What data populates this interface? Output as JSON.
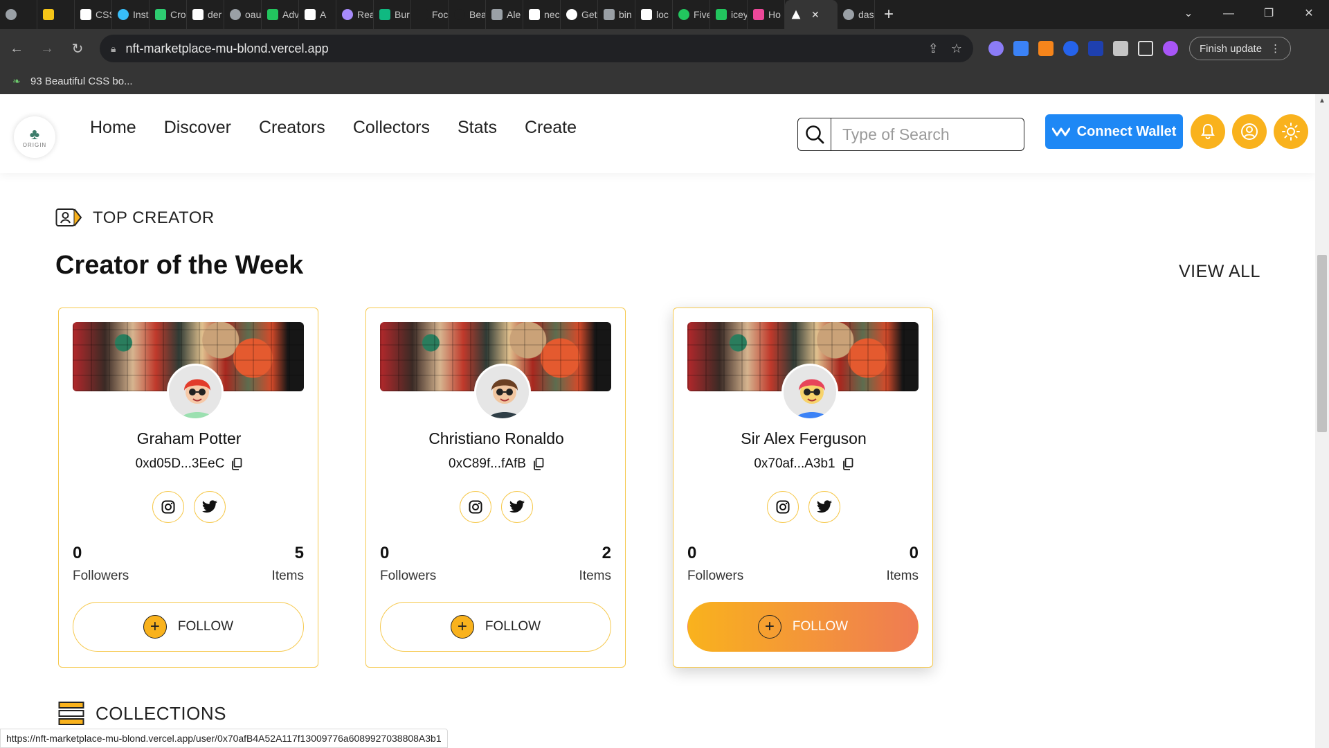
{
  "browser": {
    "tabs": [
      {
        "label": "",
        "color": "#9aa0a6"
      },
      {
        "label": "",
        "color": "#f5c518"
      },
      {
        "label": "CSS",
        "color": "#ffffff"
      },
      {
        "label": "Inst",
        "color": "#38bdf8"
      },
      {
        "label": "Cro",
        "color": "#2ecc71"
      },
      {
        "label": "der",
        "color": "#ffffff"
      },
      {
        "label": "oau",
        "color": "#9aa0a6"
      },
      {
        "label": "Adv",
        "color": "#22c55e"
      },
      {
        "label": "A",
        "color": "#ffffff"
      },
      {
        "label": "Rea",
        "color": "#a78bfa"
      },
      {
        "label": "Bur",
        "color": "#10b981"
      },
      {
        "label": "Foc",
        "color": "#1f1f1f"
      },
      {
        "label": "Bea",
        "color": "#1f1f1f"
      },
      {
        "label": "Ale",
        "color": "#9aa0a6"
      },
      {
        "label": "nec",
        "color": "#ffffff"
      },
      {
        "label": "Get",
        "color": "#ffffff"
      },
      {
        "label": "bin",
        "color": "#9aa0a6"
      },
      {
        "label": "loc",
        "color": "#ffffff"
      },
      {
        "label": "Five",
        "color": "#22c55e"
      },
      {
        "label": "icey",
        "color": "#22c55e"
      },
      {
        "label": "Ho",
        "color": "#ec4899"
      }
    ],
    "active_tab_close": "✕",
    "last_tab": {
      "label": "das",
      "color": "#9aa0a6"
    },
    "new_tab": "+",
    "url": "nft-marketplace-mu-blond.vercel.app",
    "finish_update": "Finish update",
    "bookmark": "93 Beautiful CSS bo...",
    "status_url": "https://nft-marketplace-mu-blond.vercel.app/user/0x70afB4A52A117f13009776a6089927038808A3b1"
  },
  "nav": {
    "logo_text": "ORIGIN",
    "links": [
      "Home",
      "Discover",
      "Creators",
      "Collectors",
      "Stats",
      "Create"
    ],
    "search_placeholder": "Type of Search",
    "connect_wallet": "Connect Wallet"
  },
  "section": {
    "tag": "TOP CREATOR",
    "title": "Creator of the Week",
    "view_all": "VIEW ALL",
    "collections": "COLLECTIONS"
  },
  "creators": [
    {
      "name": "Graham Potter",
      "address": "0xd05D...3EeC",
      "followers": "0",
      "followers_label": "Followers",
      "items": "5",
      "items_label": "Items",
      "follow": "FOLLOW",
      "hair": "#e23b2b",
      "shirt": "#9be0b0",
      "skin": "#f6c9a8"
    },
    {
      "name": "Christiano Ronaldo",
      "address": "0xC89f...fAfB",
      "followers": "0",
      "followers_label": "Followers",
      "items": "2",
      "items_label": "Items",
      "follow": "FOLLOW",
      "hair": "#6b3f22",
      "shirt": "#2f3e46",
      "skin": "#f1c6a0"
    },
    {
      "name": "Sir Alex Ferguson",
      "address": "0x70af...A3b1",
      "followers": "0",
      "followers_label": "Followers",
      "items": "0",
      "items_label": "Items",
      "follow": "FOLLOW",
      "hair": "#e7445a",
      "shirt": "#3b82f6",
      "skin": "#f7d36b"
    }
  ],
  "colors": {
    "accent_yellow": "#f9b21d",
    "accent_orange": "#ef7b53",
    "wallet_blue": "#1e88f5",
    "card_border": "#f6c94e"
  }
}
